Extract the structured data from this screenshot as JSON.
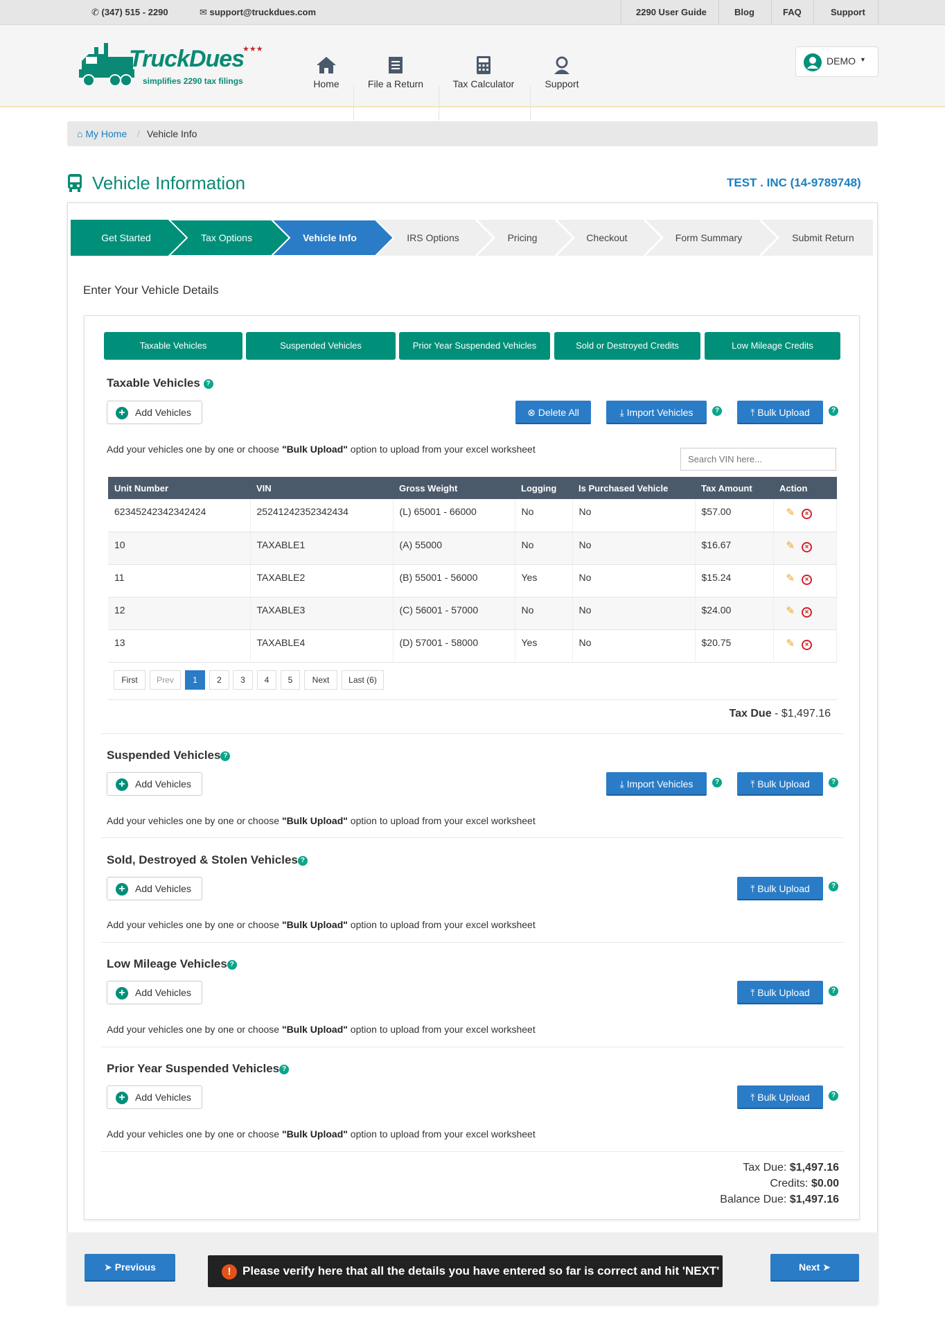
{
  "topbar": {
    "phone": "(347) 515 - 2290",
    "email": "support@truckdues.com",
    "links": [
      "2290 User Guide",
      "Blog",
      "FAQ",
      "Support"
    ]
  },
  "header": {
    "logo_text": "TruckDues",
    "logo_tagline": "simplifies 2290 tax filings",
    "nav": [
      "Home",
      "File a Return",
      "Tax Calculator",
      "Support"
    ],
    "user": "DEMO"
  },
  "breadcrumb": {
    "home": "My Home",
    "current": "Vehicle Info"
  },
  "page": {
    "title": "Vehicle Information",
    "company": "TEST . INC (14-9789748)",
    "subtitle": "Enter Your Vehicle Details"
  },
  "steps": [
    "Get Started",
    "Tax Options",
    "Vehicle Info",
    "IRS Options",
    "Pricing",
    "Checkout",
    "Form Summary",
    "Submit Return"
  ],
  "tabs": [
    "Taxable Vehicles",
    "Suspended Vehicles",
    "Prior Year Suspended Vehicles",
    "Sold or Destroyed Credits",
    "Low Mileage Credits"
  ],
  "common": {
    "add_vehicles": "Add Vehicles",
    "bulk_upload": "Bulk Upload",
    "import_vehicles": "Import Vehicles",
    "delete_all": "Delete All",
    "help_pre": "Add your vehicles one by one or choose ",
    "help_bold": "\"Bulk Upload\"",
    "help_post": " option to upload from your excel worksheet"
  },
  "taxable": {
    "title": "Taxable Vehicles",
    "search_placeholder": "Search VIN here...",
    "columns": [
      "Unit Number",
      "VIN",
      "Gross Weight",
      "Logging",
      "Is Purchased Vehicle",
      "Tax Amount",
      "Action"
    ],
    "rows": [
      [
        "62345242342342424",
        "25241242352342434",
        "(L) 65001 - 66000",
        "No",
        "No",
        "$57.00"
      ],
      [
        "10",
        "TAXABLE1",
        "(A) 55000",
        "No",
        "No",
        "$16.67"
      ],
      [
        "11",
        "TAXABLE2",
        "(B) 55001 - 56000",
        "Yes",
        "No",
        "$15.24"
      ],
      [
        "12",
        "TAXABLE3",
        "(C) 56001 - 57000",
        "No",
        "No",
        "$24.00"
      ],
      [
        "13",
        "TAXABLE4",
        "(D) 57001 - 58000",
        "Yes",
        "No",
        "$20.75"
      ]
    ],
    "pagination": [
      "First",
      "Prev",
      "1",
      "2",
      "3",
      "4",
      "5",
      "Next",
      "Last (6)"
    ],
    "tax_due_label": "Tax Due",
    "tax_due_value": " - $1,497.16"
  },
  "sections": {
    "suspended": "Suspended Vehicles",
    "sold": "Sold, Destroyed & Stolen Vehicles",
    "low_mileage": "Low Mileage Vehicles",
    "prior_year": "Prior Year Suspended Vehicles"
  },
  "summary": {
    "tax_due_label": "Tax Due: ",
    "tax_due": "$1,497.16",
    "credits_label": "Credits: ",
    "credits": "$0.00",
    "balance_label": "Balance Due: ",
    "balance": "$1,497.16"
  },
  "footer": {
    "previous": "Previous",
    "next": "Next",
    "notice": "Please verify here that all the details you have entered so far is correct and hit ",
    "notice_bold": "'NEXT'"
  },
  "colors": {
    "teal": "#00907a",
    "blue": "#2a7cc7",
    "heading": "#0a8a74",
    "company": "#1a7fc1"
  }
}
